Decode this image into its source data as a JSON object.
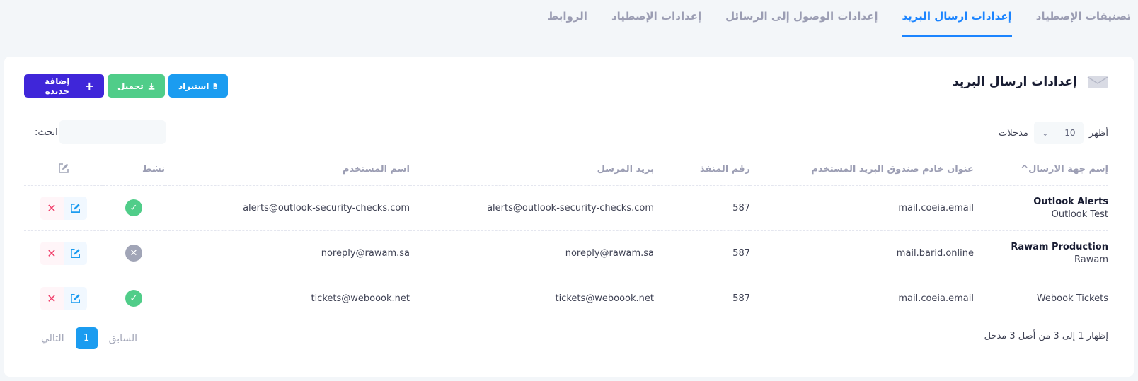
{
  "tabs": [
    {
      "label": "تصنيفات الإصطياد",
      "active": false
    },
    {
      "label": "إعدادات ارسال البريد",
      "active": true
    },
    {
      "label": "إعدادات الوصول إلى الرسائل",
      "active": false
    },
    {
      "label": "إعدادات الإصطياد",
      "active": false
    },
    {
      "label": "الروابط",
      "active": false
    }
  ],
  "card": {
    "title": "إعدادات ارسال البريد",
    "title_icon": "envelope-icon"
  },
  "toolbar": {
    "add_label": "إضافة جديدة",
    "add_icon": "plus-icon",
    "download_label": "تحميل",
    "download_icon": "download-icon",
    "import_label": "استيراد",
    "import_icon": "file-icon"
  },
  "length": {
    "show_label": "أظهر",
    "value": "10",
    "entries_label": "مدخلات"
  },
  "search": {
    "label": "ابحث:",
    "placeholder": ""
  },
  "table": {
    "headers": {
      "sender_name": "إسم جهة الارسال^",
      "server": "عنوان خادم صندوق البريد المستخدم",
      "port": "رقم المنفذ",
      "sender_email": "بريد المرسل",
      "username": "اسم المستخدم",
      "active": "نشط",
      "edit_icon": "edit-icon"
    },
    "rows": [
      {
        "name": "Outlook Alerts",
        "subname": "Outlook Test",
        "server": "mail.coeia.email",
        "port": "587",
        "sender_email": "alerts@outlook-security-checks.com",
        "username": "alerts@outlook-security-checks.com",
        "active": true
      },
      {
        "name": "Rawam Production",
        "subname": "Rawam",
        "server": "mail.barid.online",
        "port": "587",
        "sender_email": "noreply@rawam.sa",
        "username": "noreply@rawam.sa",
        "active": false
      },
      {
        "name": "",
        "subname": "Webook Tickets",
        "server": "mail.coeia.email",
        "port": "587",
        "sender_email": "tickets@weboook.net",
        "username": "tickets@weboook.net",
        "active": true
      }
    ]
  },
  "footer": {
    "info": "إظهار 1 إلى 3 من أصل 3 مدخل",
    "prev": "السابق",
    "page": "1",
    "next": "التالي"
  },
  "colors": {
    "primary": "#1b84ff",
    "add_button": "#3f26d9",
    "download_button": "#50cd89",
    "import_button": "#1b9cf0",
    "active_status": "#50cd89",
    "inactive_status": "#a1a5b7",
    "delete": "#f1416c"
  }
}
